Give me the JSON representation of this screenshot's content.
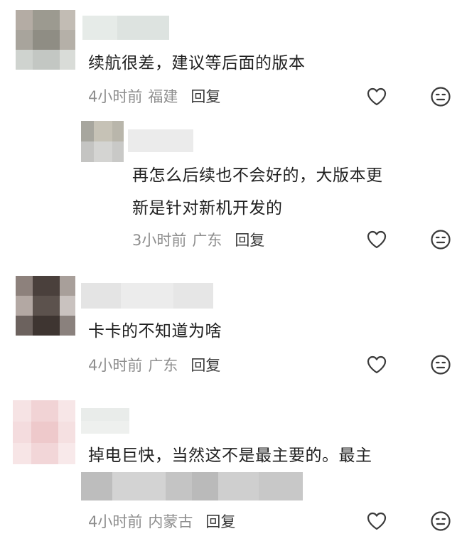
{
  "comments": [
    {
      "text": "续航很差，建议等后面的版本",
      "time": "4小时前",
      "location": "福建",
      "reply_label": "回复",
      "like_icon": "heart-outline",
      "dislike_icon": "meh-face"
    },
    {
      "text_line1": "再怎么后续也不会好的，大版本更",
      "text_line2": "新是针对新机开发的",
      "time": "3小时前",
      "location": "广东",
      "reply_label": "回复",
      "like_icon": "heart-outline",
      "dislike_icon": "meh-face"
    },
    {
      "text": "卡卡的不知道为啥",
      "time": "4小时前",
      "location": "广东",
      "reply_label": "回复",
      "like_icon": "heart-outline",
      "dislike_icon": "meh-face"
    },
    {
      "text": "掉电巨快，当然这不是最主要的。最主",
      "time": "4小时前",
      "location": "内蒙古",
      "reply_label": "回复",
      "like_icon": "heart-outline",
      "dislike_icon": "meh-face"
    }
  ],
  "colors": {
    "text": "#1f1f1f",
    "meta": "#8e8e8e",
    "reply": "#3c3c3c",
    "icon": "#3a3a3a"
  }
}
